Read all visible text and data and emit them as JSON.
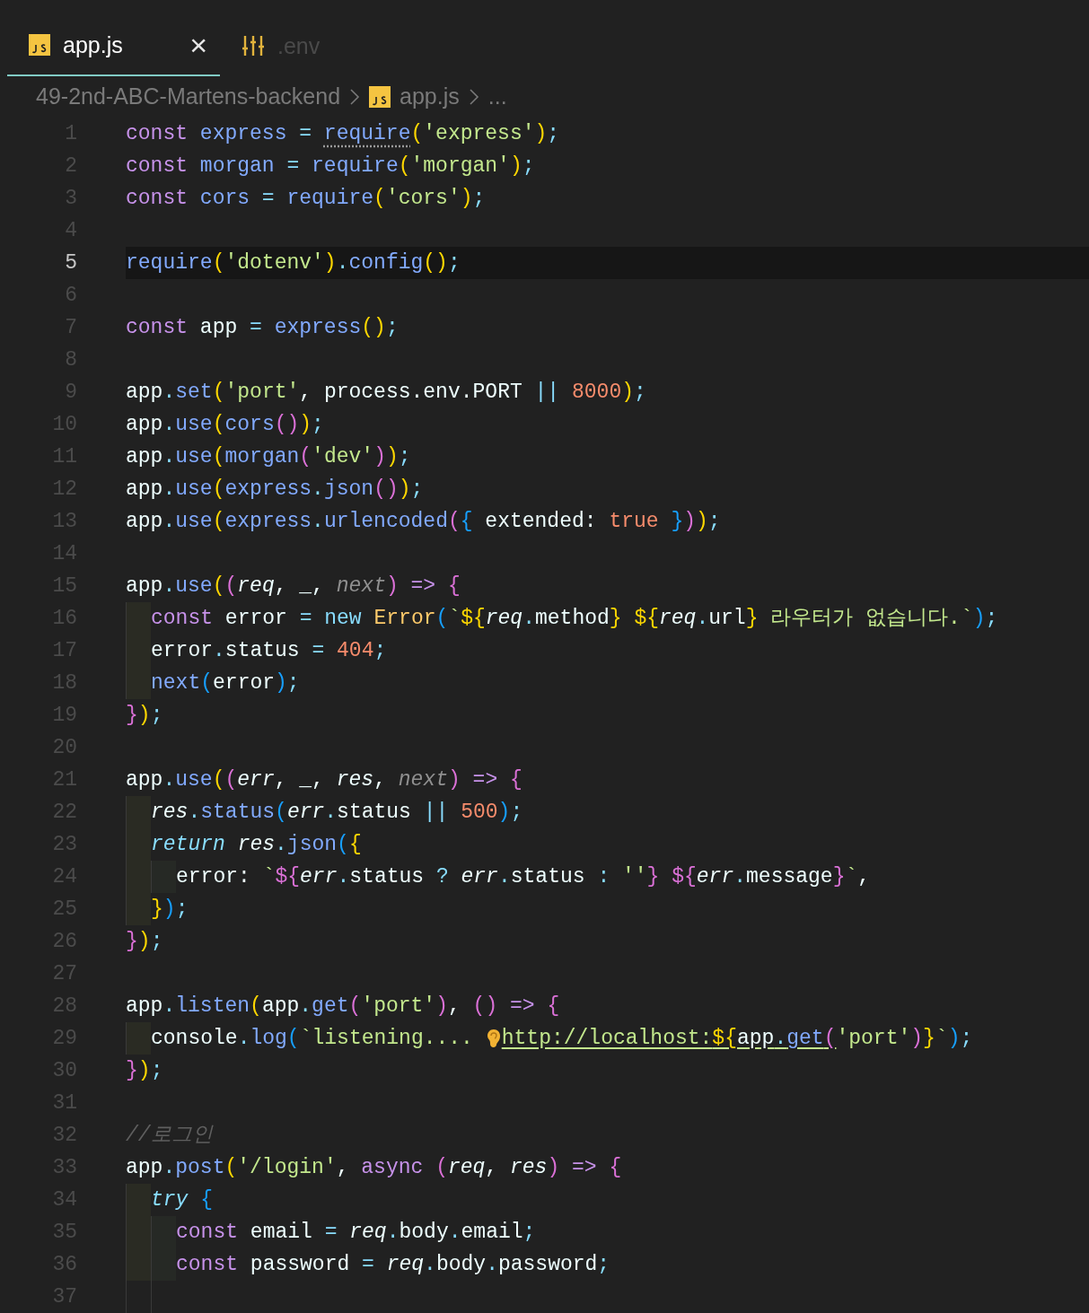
{
  "tabs": [
    {
      "label": "app.js",
      "kind": "js",
      "selected": true,
      "close": "×"
    },
    {
      "label": ".env",
      "kind": "env",
      "selected": false
    }
  ],
  "breadcrumb": {
    "folder": "49-2nd-ABC-Martens-backend",
    "file": "app.js",
    "more": "..."
  },
  "lines": [
    {
      "number": "1",
      "current": false,
      "tokens": [
        {
          "kind": "kw",
          "text": "const "
        },
        {
          "kind": "fn",
          "text": "express "
        },
        {
          "kind": "op",
          "text": "= "
        },
        {
          "kind": "hint",
          "text": "require"
        },
        {
          "kind": "p1",
          "text": "("
        },
        {
          "kind": "str",
          "text": "'express'"
        },
        {
          "kind": "p1",
          "text": ")"
        },
        {
          "kind": "op",
          "text": ";"
        }
      ]
    },
    {
      "number": "2",
      "current": false,
      "tokens": [
        {
          "kind": "kw",
          "text": "const "
        },
        {
          "kind": "fn",
          "text": "morgan "
        },
        {
          "kind": "op",
          "text": "= "
        },
        {
          "kind": "fn",
          "text": "require"
        },
        {
          "kind": "p1",
          "text": "("
        },
        {
          "kind": "str",
          "text": "'morgan'"
        },
        {
          "kind": "p1",
          "text": ")"
        },
        {
          "kind": "op",
          "text": ";"
        }
      ]
    },
    {
      "number": "3",
      "current": false,
      "tokens": [
        {
          "kind": "kw",
          "text": "const "
        },
        {
          "kind": "fn",
          "text": "cors "
        },
        {
          "kind": "op",
          "text": "= "
        },
        {
          "kind": "fn",
          "text": "require"
        },
        {
          "kind": "p1",
          "text": "("
        },
        {
          "kind": "str",
          "text": "'cors'"
        },
        {
          "kind": "p1",
          "text": ")"
        },
        {
          "kind": "op",
          "text": ";"
        }
      ]
    },
    {
      "number": "4",
      "current": false
    },
    {
      "number": "5",
      "current": true,
      "tokens": [
        {
          "kind": "fn",
          "text": "require"
        },
        {
          "kind": "p1",
          "text": "("
        },
        {
          "kind": "str",
          "text": "'dotenv'"
        },
        {
          "kind": "p1",
          "text": ")"
        },
        {
          "kind": "op",
          "text": "."
        },
        {
          "kind": "fn",
          "text": "config"
        },
        {
          "kind": "p1",
          "text": "()"
        },
        {
          "kind": "op",
          "text": ";"
        }
      ]
    },
    {
      "number": "6",
      "current": false
    },
    {
      "number": "7",
      "current": false,
      "tokens": [
        {
          "kind": "kw",
          "text": "const "
        },
        {
          "kind": "id",
          "text": "app "
        },
        {
          "kind": "op",
          "text": "= "
        },
        {
          "kind": "fn",
          "text": "express"
        },
        {
          "kind": "p1",
          "text": "()"
        },
        {
          "kind": "op",
          "text": ";"
        }
      ]
    },
    {
      "number": "8",
      "current": false
    },
    {
      "number": "9",
      "current": false,
      "tokens": [
        {
          "kind": "id",
          "text": "app"
        },
        {
          "kind": "op",
          "text": "."
        },
        {
          "kind": "fn",
          "text": "set"
        },
        {
          "kind": "p1",
          "text": "("
        },
        {
          "kind": "str",
          "text": "'port'"
        },
        {
          "kind": "id",
          "text": ", process.env.PORT "
        },
        {
          "kind": "op",
          "text": "|| "
        },
        {
          "kind": "num",
          "text": "8000"
        },
        {
          "kind": "p1",
          "text": ")"
        },
        {
          "kind": "op",
          "text": ";"
        }
      ]
    },
    {
      "number": "10",
      "current": false,
      "tokens": [
        {
          "kind": "id",
          "text": "app"
        },
        {
          "kind": "op",
          "text": "."
        },
        {
          "kind": "fn",
          "text": "use"
        },
        {
          "kind": "p1",
          "text": "("
        },
        {
          "kind": "fn",
          "text": "cors"
        },
        {
          "kind": "p2",
          "text": "()"
        },
        {
          "kind": "p1",
          "text": ")"
        },
        {
          "kind": "op",
          "text": ";"
        }
      ]
    },
    {
      "number": "11",
      "current": false,
      "tokens": [
        {
          "kind": "id",
          "text": "app"
        },
        {
          "kind": "op",
          "text": "."
        },
        {
          "kind": "fn",
          "text": "use"
        },
        {
          "kind": "p1",
          "text": "("
        },
        {
          "kind": "fn",
          "text": "morgan"
        },
        {
          "kind": "p2",
          "text": "("
        },
        {
          "kind": "str",
          "text": "'dev'"
        },
        {
          "kind": "p2",
          "text": ")"
        },
        {
          "kind": "p1",
          "text": ")"
        },
        {
          "kind": "op",
          "text": ";"
        }
      ]
    },
    {
      "number": "12",
      "current": false,
      "tokens": [
        {
          "kind": "id",
          "text": "app"
        },
        {
          "kind": "op",
          "text": "."
        },
        {
          "kind": "fn",
          "text": "use"
        },
        {
          "kind": "p1",
          "text": "("
        },
        {
          "kind": "fn",
          "text": "express"
        },
        {
          "kind": "op",
          "text": "."
        },
        {
          "kind": "fn",
          "text": "json"
        },
        {
          "kind": "p2",
          "text": "()"
        },
        {
          "kind": "p1",
          "text": ")"
        },
        {
          "kind": "op",
          "text": ";"
        }
      ]
    },
    {
      "number": "13",
      "current": false,
      "tokens": [
        {
          "kind": "id",
          "text": "app"
        },
        {
          "kind": "op",
          "text": "."
        },
        {
          "kind": "fn",
          "text": "use"
        },
        {
          "kind": "p1",
          "text": "("
        },
        {
          "kind": "fn",
          "text": "express"
        },
        {
          "kind": "op",
          "text": "."
        },
        {
          "kind": "fn",
          "text": "urlencoded"
        },
        {
          "kind": "p2",
          "text": "("
        },
        {
          "kind": "p3",
          "text": "{ "
        },
        {
          "kind": "id",
          "text": "extended: "
        },
        {
          "kind": "num",
          "text": "true "
        },
        {
          "kind": "p3",
          "text": "}"
        },
        {
          "kind": "p2",
          "text": ")"
        },
        {
          "kind": "p1",
          "text": ")"
        },
        {
          "kind": "op",
          "text": ";"
        }
      ]
    },
    {
      "number": "14",
      "current": false
    },
    {
      "number": "15",
      "current": false,
      "tokens": [
        {
          "kind": "id",
          "text": "app"
        },
        {
          "kind": "op",
          "text": "."
        },
        {
          "kind": "fn",
          "text": "use"
        },
        {
          "kind": "p1",
          "text": "("
        },
        {
          "kind": "p2",
          "text": "("
        },
        {
          "kind": "param",
          "text": "req"
        },
        {
          "kind": "id",
          "text": ", _, "
        },
        {
          "kind": "unused",
          "text": "next"
        },
        {
          "kind": "p2",
          "text": ") "
        },
        {
          "kind": "kw",
          "text": "=> "
        },
        {
          "kind": "p2",
          "text": "{"
        }
      ]
    },
    {
      "number": "16",
      "current": false,
      "guides": [
        {
          "kind": "block"
        }
      ],
      "tokens": [
        {
          "kind": "kw",
          "text": "const "
        },
        {
          "kind": "id",
          "text": "error "
        },
        {
          "kind": "op",
          "text": "= "
        },
        {
          "kind": "op",
          "text": "new "
        },
        {
          "kind": "cls",
          "text": "Error"
        },
        {
          "kind": "p3",
          "text": "("
        },
        {
          "kind": "str",
          "text": "`"
        },
        {
          "kind": "p1",
          "text": "${"
        },
        {
          "kind": "param",
          "text": "req"
        },
        {
          "kind": "op",
          "text": "."
        },
        {
          "kind": "id",
          "text": "method"
        },
        {
          "kind": "p1",
          "text": "} ${"
        },
        {
          "kind": "param",
          "text": "req"
        },
        {
          "kind": "op",
          "text": "."
        },
        {
          "kind": "id",
          "text": "url"
        },
        {
          "kind": "p1",
          "text": "}"
        },
        {
          "kind": "str",
          "text": " 라우터가 없습니다.`"
        },
        {
          "kind": "p3",
          "text": ")"
        },
        {
          "kind": "op",
          "text": ";"
        }
      ]
    },
    {
      "number": "17",
      "current": false,
      "guides": [
        {
          "kind": "block"
        }
      ],
      "tokens": [
        {
          "kind": "id",
          "text": "error"
        },
        {
          "kind": "op",
          "text": "."
        },
        {
          "kind": "id",
          "text": "status "
        },
        {
          "kind": "op",
          "text": "= "
        },
        {
          "kind": "num",
          "text": "404"
        },
        {
          "kind": "op",
          "text": ";"
        }
      ]
    },
    {
      "number": "18",
      "current": false,
      "guides": [
        {
          "kind": "block"
        }
      ],
      "tokens": [
        {
          "kind": "fn",
          "text": "next"
        },
        {
          "kind": "p3",
          "text": "("
        },
        {
          "kind": "id",
          "text": "error"
        },
        {
          "kind": "p3",
          "text": ")"
        },
        {
          "kind": "op",
          "text": ";"
        }
      ]
    },
    {
      "number": "19",
      "current": false,
      "tokens": [
        {
          "kind": "p2",
          "text": "}"
        },
        {
          "kind": "p1",
          "text": ")"
        },
        {
          "kind": "op",
          "text": ";"
        }
      ]
    },
    {
      "number": "20",
      "current": false
    },
    {
      "number": "21",
      "current": false,
      "tokens": [
        {
          "kind": "id",
          "text": "app"
        },
        {
          "kind": "op",
          "text": "."
        },
        {
          "kind": "fn",
          "text": "use"
        },
        {
          "kind": "p1",
          "text": "("
        },
        {
          "kind": "p2",
          "text": "("
        },
        {
          "kind": "param",
          "text": "err"
        },
        {
          "kind": "id",
          "text": ", _, "
        },
        {
          "kind": "param",
          "text": "res"
        },
        {
          "kind": "id",
          "text": ", "
        },
        {
          "kind": "unused",
          "text": "next"
        },
        {
          "kind": "p2",
          "text": ") "
        },
        {
          "kind": "kw",
          "text": "=> "
        },
        {
          "kind": "p2",
          "text": "{"
        }
      ]
    },
    {
      "number": "22",
      "current": false,
      "guides": [
        {
          "kind": "block"
        }
      ],
      "tokens": [
        {
          "kind": "param",
          "text": "res"
        },
        {
          "kind": "op",
          "text": "."
        },
        {
          "kind": "fn",
          "text": "status"
        },
        {
          "kind": "p3",
          "text": "("
        },
        {
          "kind": "param",
          "text": "err"
        },
        {
          "kind": "op",
          "text": "."
        },
        {
          "kind": "id",
          "text": "status "
        },
        {
          "kind": "op",
          "text": "|| "
        },
        {
          "kind": "num",
          "text": "500"
        },
        {
          "kind": "p3",
          "text": ")"
        },
        {
          "kind": "op",
          "text": ";"
        }
      ]
    },
    {
      "number": "23",
      "current": false,
      "guides": [
        {
          "kind": "block"
        }
      ],
      "tokens": [
        {
          "kind": "ctl",
          "text": "return "
        },
        {
          "kind": "param",
          "text": "res"
        },
        {
          "kind": "op",
          "text": "."
        },
        {
          "kind": "fn",
          "text": "json"
        },
        {
          "kind": "p3",
          "text": "("
        },
        {
          "kind": "p1",
          "text": "{"
        }
      ]
    },
    {
      "number": "24",
      "current": false,
      "guides": [
        {
          "kind": "block"
        },
        {
          "kind": "block"
        }
      ],
      "tokens": [
        {
          "kind": "id",
          "text": "error: "
        },
        {
          "kind": "str",
          "text": "`"
        },
        {
          "kind": "p2",
          "text": "${"
        },
        {
          "kind": "param",
          "text": "err"
        },
        {
          "kind": "op",
          "text": "."
        },
        {
          "kind": "id",
          "text": "status "
        },
        {
          "kind": "op",
          "text": "? "
        },
        {
          "kind": "param",
          "text": "err"
        },
        {
          "kind": "op",
          "text": "."
        },
        {
          "kind": "id",
          "text": "status "
        },
        {
          "kind": "op",
          "text": ": "
        },
        {
          "kind": "str",
          "text": "''"
        },
        {
          "kind": "p2",
          "text": "} ${"
        },
        {
          "kind": "param",
          "text": "err"
        },
        {
          "kind": "op",
          "text": "."
        },
        {
          "kind": "id",
          "text": "message"
        },
        {
          "kind": "p2",
          "text": "}"
        },
        {
          "kind": "str",
          "text": "`"
        },
        {
          "kind": "id",
          "text": ","
        }
      ]
    },
    {
      "number": "25",
      "current": false,
      "guides": [
        {
          "kind": "block"
        }
      ],
      "tokens": [
        {
          "kind": "p1",
          "text": "}"
        },
        {
          "kind": "p3",
          "text": ")"
        },
        {
          "kind": "op",
          "text": ";"
        }
      ]
    },
    {
      "number": "26",
      "current": false,
      "tokens": [
        {
          "kind": "p2",
          "text": "}"
        },
        {
          "kind": "p1",
          "text": ")"
        },
        {
          "kind": "op",
          "text": ";"
        }
      ]
    },
    {
      "number": "27",
      "current": false
    },
    {
      "number": "28",
      "current": false,
      "tokens": [
        {
          "kind": "id",
          "text": "app"
        },
        {
          "kind": "op",
          "text": "."
        },
        {
          "kind": "fn",
          "text": "listen"
        },
        {
          "kind": "p1",
          "text": "("
        },
        {
          "kind": "id",
          "text": "app"
        },
        {
          "kind": "op",
          "text": "."
        },
        {
          "kind": "fn",
          "text": "get"
        },
        {
          "kind": "p2",
          "text": "("
        },
        {
          "kind": "str",
          "text": "'port'"
        },
        {
          "kind": "p2",
          "text": ")"
        },
        {
          "kind": "id",
          "text": ", "
        },
        {
          "kind": "p2",
          "text": "() "
        },
        {
          "kind": "kw",
          "text": "=> "
        },
        {
          "kind": "p2",
          "text": "{"
        }
      ]
    },
    {
      "number": "29",
      "current": false,
      "guides": [
        {
          "kind": "block"
        }
      ],
      "tokens": [
        {
          "kind": "id",
          "text": "console"
        },
        {
          "kind": "op",
          "text": "."
        },
        {
          "kind": "fn",
          "text": "log"
        },
        {
          "kind": "p3",
          "text": "("
        },
        {
          "kind": "str",
          "text": "`listening.... "
        },
        {
          "kind": "ear"
        },
        {
          "kind": "strlink",
          "text": "http://localhost:"
        },
        {
          "kind": "p1link",
          "text": "${"
        },
        {
          "kind": "idlink",
          "text": "app"
        },
        {
          "kind": "oplink",
          "text": "."
        },
        {
          "kind": "fnlink",
          "text": "get"
        },
        {
          "kind": "p2link",
          "text": "("
        },
        {
          "kind": "str",
          "text": "'port'"
        },
        {
          "kind": "p2",
          "text": ")"
        },
        {
          "kind": "p1",
          "text": "}"
        },
        {
          "kind": "str",
          "text": "`"
        },
        {
          "kind": "p3",
          "text": ")"
        },
        {
          "kind": "op",
          "text": ";"
        }
      ]
    },
    {
      "number": "30",
      "current": false,
      "tokens": [
        {
          "kind": "p2",
          "text": "}"
        },
        {
          "kind": "p1",
          "text": ")"
        },
        {
          "kind": "op",
          "text": ";"
        }
      ]
    },
    {
      "number": "31",
      "current": false
    },
    {
      "number": "32",
      "current": false,
      "tokens": [
        {
          "kind": "cm",
          "text": "//로그인"
        }
      ]
    },
    {
      "number": "33",
      "current": false,
      "tokens": [
        {
          "kind": "id",
          "text": "app"
        },
        {
          "kind": "op",
          "text": "."
        },
        {
          "kind": "fn",
          "text": "post"
        },
        {
          "kind": "p1",
          "text": "("
        },
        {
          "kind": "str",
          "text": "'/login'"
        },
        {
          "kind": "id",
          "text": ", "
        },
        {
          "kind": "kw",
          "text": "async "
        },
        {
          "kind": "p2",
          "text": "("
        },
        {
          "kind": "param",
          "text": "req"
        },
        {
          "kind": "id",
          "text": ", "
        },
        {
          "kind": "param",
          "text": "res"
        },
        {
          "kind": "p2",
          "text": ") "
        },
        {
          "kind": "kw",
          "text": "=> "
        },
        {
          "kind": "p2",
          "text": "{"
        }
      ]
    },
    {
      "number": "34",
      "current": false,
      "guides": [
        {
          "kind": "block"
        }
      ],
      "tokens": [
        {
          "kind": "ctl",
          "text": "try "
        },
        {
          "kind": "p3",
          "text": "{"
        }
      ]
    },
    {
      "number": "35",
      "current": false,
      "guides": [
        {
          "kind": "block"
        },
        {
          "kind": "block"
        }
      ],
      "tokens": [
        {
          "kind": "kw",
          "text": "const "
        },
        {
          "kind": "id",
          "text": "email "
        },
        {
          "kind": "op",
          "text": "= "
        },
        {
          "kind": "param",
          "text": "req"
        },
        {
          "kind": "op",
          "text": "."
        },
        {
          "kind": "id",
          "text": "body"
        },
        {
          "kind": "op",
          "text": "."
        },
        {
          "kind": "id",
          "text": "email"
        },
        {
          "kind": "op",
          "text": ";"
        }
      ]
    },
    {
      "number": "36",
      "current": false,
      "guides": [
        {
          "kind": "block"
        },
        {
          "kind": "block"
        }
      ],
      "tokens": [
        {
          "kind": "kw",
          "text": "const "
        },
        {
          "kind": "id",
          "text": "password "
        },
        {
          "kind": "op",
          "text": "= "
        },
        {
          "kind": "param",
          "text": "req"
        },
        {
          "kind": "op",
          "text": "."
        },
        {
          "kind": "id",
          "text": "body"
        },
        {
          "kind": "op",
          "text": "."
        },
        {
          "kind": "id",
          "text": "password"
        },
        {
          "kind": "op",
          "text": ";"
        }
      ]
    },
    {
      "number": "37",
      "current": false,
      "guides": [
        {
          "kind": "line"
        },
        {
          "kind": "line"
        }
      ]
    }
  ]
}
